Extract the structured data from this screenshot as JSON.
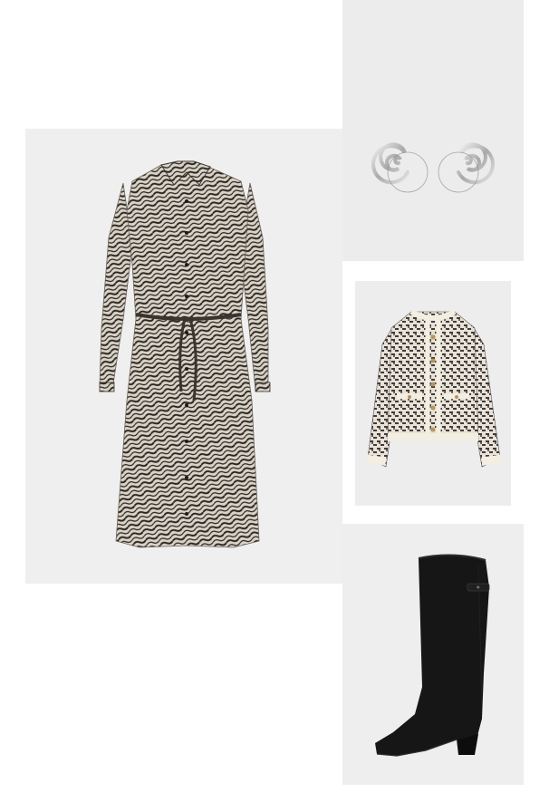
{
  "board": {
    "background": "#ffffff",
    "panel_color": "#efefef"
  },
  "items": [
    {
      "key": "dress",
      "label": "",
      "icon": "zebra-print-shirt-dress"
    },
    {
      "key": "earrings",
      "label": "",
      "icon": "silver-spiral-earrings"
    },
    {
      "key": "cardigan",
      "label": "",
      "icon": "tweed-cardigan"
    },
    {
      "key": "boot",
      "label": "",
      "icon": "black-knee-high-boot"
    }
  ],
  "colors": {
    "dress_base": "#d8d1c4",
    "dress_pattern": "#2b2622",
    "silver": "#c9c9c9",
    "cardigan_cream": "#f1ece0",
    "cardigan_pattern": "#3f3a3f",
    "boot": "#151515"
  }
}
